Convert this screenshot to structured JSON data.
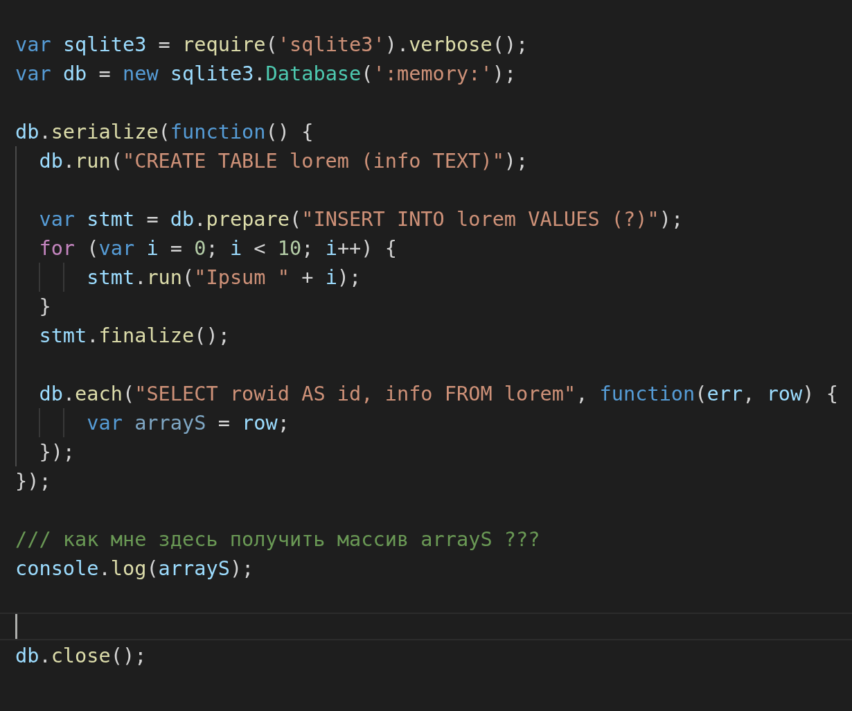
{
  "editor": {
    "lines": [
      {
        "kind": "code",
        "tokens": [
          {
            "text": "var ",
            "kind": "keyword"
          },
          {
            "text": "sqlite3",
            "kind": "variable"
          },
          {
            "text": " = ",
            "kind": "plain"
          },
          {
            "text": "require",
            "kind": "function"
          },
          {
            "text": "(",
            "kind": "plain"
          },
          {
            "text": "'sqlite3'",
            "kind": "string"
          },
          {
            "text": ").",
            "kind": "plain"
          },
          {
            "text": "verbose",
            "kind": "function"
          },
          {
            "text": "();",
            "kind": "plain"
          }
        ]
      },
      {
        "kind": "code",
        "tokens": [
          {
            "text": "var ",
            "kind": "keyword"
          },
          {
            "text": "db",
            "kind": "variable"
          },
          {
            "text": " = ",
            "kind": "plain"
          },
          {
            "text": "new ",
            "kind": "keyword"
          },
          {
            "text": "sqlite3",
            "kind": "variable"
          },
          {
            "text": ".",
            "kind": "plain"
          },
          {
            "text": "Database",
            "kind": "class"
          },
          {
            "text": "(",
            "kind": "plain"
          },
          {
            "text": "':memory:'",
            "kind": "string"
          },
          {
            "text": ");",
            "kind": "plain"
          }
        ]
      },
      {
        "kind": "blank"
      },
      {
        "kind": "code",
        "tokens": [
          {
            "text": "db",
            "kind": "variable"
          },
          {
            "text": ".",
            "kind": "plain"
          },
          {
            "text": "serialize",
            "kind": "function"
          },
          {
            "text": "(",
            "kind": "plain"
          },
          {
            "text": "function",
            "kind": "keyword"
          },
          {
            "text": "() {",
            "kind": "plain"
          }
        ]
      },
      {
        "kind": "code",
        "tokens": [
          {
            "text": "  db",
            "kind": "variable"
          },
          {
            "text": ".",
            "kind": "plain"
          },
          {
            "text": "run",
            "kind": "function"
          },
          {
            "text": "(",
            "kind": "plain"
          },
          {
            "text": "\"CREATE TABLE lorem (info TEXT)\"",
            "kind": "string"
          },
          {
            "text": ");",
            "kind": "plain"
          }
        ]
      },
      {
        "kind": "blank"
      },
      {
        "kind": "code",
        "tokens": [
          {
            "text": "  var ",
            "kind": "keyword"
          },
          {
            "text": "stmt",
            "kind": "variable"
          },
          {
            "text": " = ",
            "kind": "plain"
          },
          {
            "text": "db",
            "kind": "variable"
          },
          {
            "text": ".",
            "kind": "plain"
          },
          {
            "text": "prepare",
            "kind": "function"
          },
          {
            "text": "(",
            "kind": "plain"
          },
          {
            "text": "\"INSERT INTO lorem VALUES (?)\"",
            "kind": "string"
          },
          {
            "text": ");",
            "kind": "plain"
          }
        ]
      },
      {
        "kind": "code",
        "tokens": [
          {
            "text": "  for",
            "kind": "control"
          },
          {
            "text": " (",
            "kind": "plain"
          },
          {
            "text": "var ",
            "kind": "keyword"
          },
          {
            "text": "i",
            "kind": "variable"
          },
          {
            "text": " = ",
            "kind": "plain"
          },
          {
            "text": "0",
            "kind": "number"
          },
          {
            "text": "; ",
            "kind": "plain"
          },
          {
            "text": "i",
            "kind": "variable"
          },
          {
            "text": " < ",
            "kind": "plain"
          },
          {
            "text": "10",
            "kind": "number"
          },
          {
            "text": "; ",
            "kind": "plain"
          },
          {
            "text": "i",
            "kind": "variable"
          },
          {
            "text": "++) {",
            "kind": "plain"
          }
        ]
      },
      {
        "kind": "code",
        "tokens": [
          {
            "text": "      stmt",
            "kind": "variable"
          },
          {
            "text": ".",
            "kind": "plain"
          },
          {
            "text": "run",
            "kind": "function"
          },
          {
            "text": "(",
            "kind": "plain"
          },
          {
            "text": "\"Ipsum \"",
            "kind": "string"
          },
          {
            "text": " + ",
            "kind": "plain"
          },
          {
            "text": "i",
            "kind": "variable"
          },
          {
            "text": ");",
            "kind": "plain"
          }
        ]
      },
      {
        "kind": "code",
        "tokens": [
          {
            "text": "  }",
            "kind": "plain"
          }
        ]
      },
      {
        "kind": "code",
        "tokens": [
          {
            "text": "  stmt",
            "kind": "variable"
          },
          {
            "text": ".",
            "kind": "plain"
          },
          {
            "text": "finalize",
            "kind": "function"
          },
          {
            "text": "();",
            "kind": "plain"
          }
        ]
      },
      {
        "kind": "blank"
      },
      {
        "kind": "code",
        "tokens": [
          {
            "text": "  db",
            "kind": "variable"
          },
          {
            "text": ".",
            "kind": "plain"
          },
          {
            "text": "each",
            "kind": "function"
          },
          {
            "text": "(",
            "kind": "plain"
          },
          {
            "text": "\"SELECT rowid AS id, info FROM lorem\"",
            "kind": "string"
          },
          {
            "text": ", ",
            "kind": "plain"
          },
          {
            "text": "function",
            "kind": "keyword"
          },
          {
            "text": "(",
            "kind": "plain"
          },
          {
            "text": "err",
            "kind": "variable"
          },
          {
            "text": ", ",
            "kind": "plain"
          },
          {
            "text": "row",
            "kind": "variable"
          },
          {
            "text": ") {",
            "kind": "plain"
          }
        ]
      },
      {
        "kind": "code",
        "tokens": [
          {
            "text": "      var ",
            "kind": "keyword"
          },
          {
            "text": "arrayS",
            "kind": "unused"
          },
          {
            "text": " = ",
            "kind": "plain"
          },
          {
            "text": "row",
            "kind": "variable"
          },
          {
            "text": ";",
            "kind": "plain"
          }
        ]
      },
      {
        "kind": "code",
        "tokens": [
          {
            "text": "  });",
            "kind": "plain"
          }
        ]
      },
      {
        "kind": "code",
        "tokens": [
          {
            "text": "});",
            "kind": "plain"
          }
        ]
      },
      {
        "kind": "blank"
      },
      {
        "kind": "code",
        "tokens": [
          {
            "text": "/// как мне здесь получить массив arrayS ???",
            "kind": "comment"
          }
        ]
      },
      {
        "kind": "code",
        "tokens": [
          {
            "text": "console",
            "kind": "variable"
          },
          {
            "text": ".",
            "kind": "plain"
          },
          {
            "text": "log",
            "kind": "function"
          },
          {
            "text": "(",
            "kind": "plain"
          },
          {
            "text": "arrayS",
            "kind": "variable"
          },
          {
            "text": ");",
            "kind": "plain"
          }
        ]
      },
      {
        "kind": "blank"
      },
      {
        "kind": "cursor"
      },
      {
        "kind": "code",
        "tokens": [
          {
            "text": "db",
            "kind": "variable"
          },
          {
            "text": ".",
            "kind": "plain"
          },
          {
            "text": "close",
            "kind": "function"
          },
          {
            "text": "();",
            "kind": "plain"
          }
        ]
      }
    ]
  }
}
